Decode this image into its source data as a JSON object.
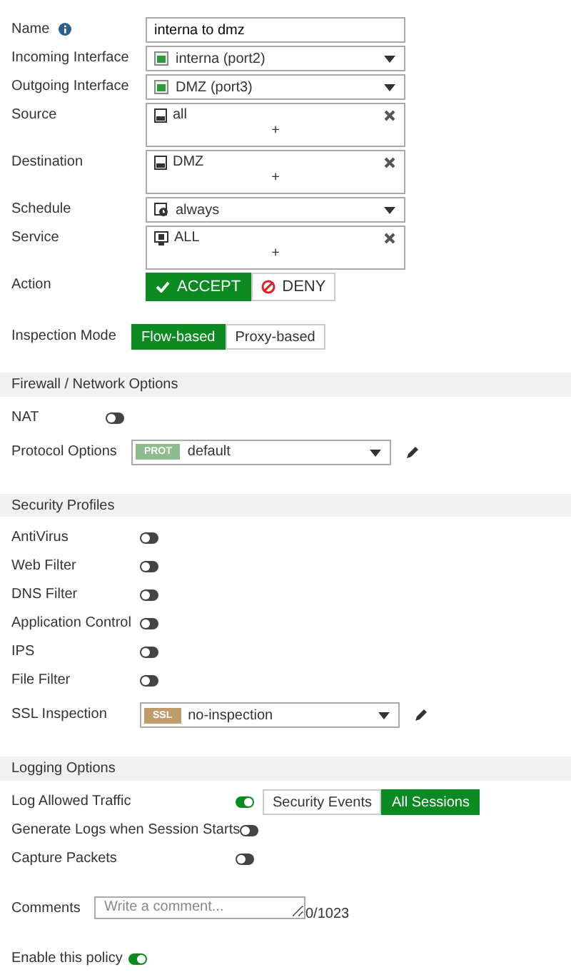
{
  "policy_fields": [
    {
      "kind": "text",
      "label": "Name",
      "info": true,
      "value": "interna to dmz"
    },
    {
      "kind": "interface-select",
      "label": "Incoming Interface",
      "value": "interna (port2)"
    },
    {
      "kind": "interface-select",
      "label": "Outgoing Interface",
      "value": "DMZ (port3)"
    },
    {
      "kind": "address-list",
      "label": "Source",
      "value": "all",
      "add": "+"
    },
    {
      "kind": "address-list",
      "label": "Destination",
      "value": "DMZ",
      "add": "+"
    },
    {
      "kind": "schedule-select",
      "label": "Schedule",
      "value": "always"
    },
    {
      "kind": "service-list",
      "label": "Service",
      "value": "ALL",
      "add": "+"
    }
  ],
  "action": {
    "label": "Action",
    "options": [
      {
        "label": "ACCEPT",
        "selected": true
      },
      {
        "label": "DENY",
        "selected": false
      }
    ]
  },
  "inspection_mode": {
    "label": "Inspection Mode",
    "options": [
      {
        "label": "Flow-based",
        "selected": true
      },
      {
        "label": "Proxy-based",
        "selected": false
      }
    ]
  },
  "sections": [
    {
      "title": "Firewall / Network Options",
      "rows": [
        {
          "kind": "toggle",
          "label": "NAT",
          "on": false
        },
        {
          "kind": "profile-select",
          "label": "Protocol Options",
          "tag": "PROT",
          "color": "#8fbc8f",
          "value": "default"
        }
      ]
    },
    {
      "title": "Security Profiles",
      "rows": [
        {
          "kind": "toggle",
          "label": "AntiVirus",
          "on": false
        },
        {
          "kind": "toggle",
          "label": "Web Filter",
          "on": false
        },
        {
          "kind": "toggle",
          "label": "DNS Filter",
          "on": false
        },
        {
          "kind": "toggle",
          "label": "Application Control",
          "on": false
        },
        {
          "kind": "toggle",
          "label": "IPS",
          "on": false
        },
        {
          "kind": "toggle",
          "label": "File Filter",
          "on": false
        },
        {
          "kind": "profile-select",
          "label": "SSL Inspection",
          "tag": "SSL",
          "color": "#c09b6b",
          "value": "no-inspection"
        }
      ]
    },
    {
      "title": "Logging Options",
      "rows": [
        {
          "kind": "toggle-options",
          "label": "Log Allowed Traffic",
          "on": true,
          "options": [
            {
              "label": "Security Events",
              "selected": false
            },
            {
              "label": "All Sessions",
              "selected": true
            }
          ]
        },
        {
          "kind": "toggle",
          "label": "Generate Logs when Session Starts",
          "on": false
        },
        {
          "kind": "toggle",
          "label": "Capture Packets",
          "on": false
        }
      ]
    }
  ],
  "comments": {
    "label": "Comments",
    "placeholder": "Write a comment...",
    "counter": "0/1023"
  },
  "enable": {
    "label": "Enable this policy",
    "on": true
  }
}
